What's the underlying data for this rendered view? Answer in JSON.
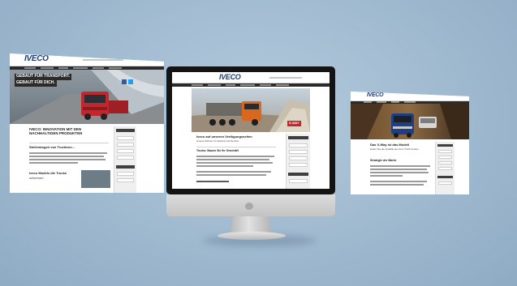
{
  "brand": {
    "logo": "IVECO"
  },
  "left_page": {
    "hero_slogan_1": "GEBAUT FÜR TRANSPORT.",
    "hero_slogan_2": "GEBAUT FÜR DICH.",
    "heading": "IVECO: INNOVATION MIT DEN NACHHALTIGEN PRODUKTEN",
    "subheading": "Stellenbogen von Trucktore...",
    "section2_title": "Iveco Models die Trucks",
    "section2_sub": "aufnehmen"
  },
  "center_page": {
    "heading": "Iveco auf unseren Verfügungsseiten",
    "subheading": "Unsere Partner im Vertrieb und Service",
    "section_title": "Trucks: Bauen Sie Ihr Geschäft",
    "badge": "S-WAY"
  },
  "right_page": {
    "heading": "Das X-Way ist das Modell",
    "subheading": "Holen Sie die Qualität aus dem Truck heraus",
    "section_title": "Strategie der Marke"
  },
  "colors": {
    "background": "#9fb9cf",
    "logo": "#1c3a74",
    "nav_bar": "#2a2a2a",
    "truck_red": "#c1272d",
    "truck_orange": "#d8671f",
    "truck_blue": "#1f3f84"
  },
  "icons": [
    "facebook-icon",
    "twitter-icon",
    "apple-logo-icon"
  ]
}
